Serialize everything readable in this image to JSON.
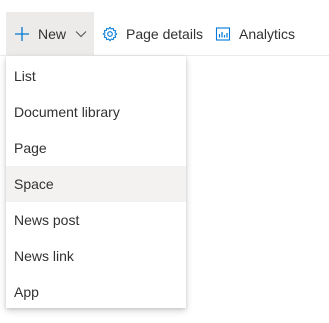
{
  "toolbar": {
    "new_label": "New",
    "page_details_label": "Page details",
    "analytics_label": "Analytics"
  },
  "new_menu": {
    "items": [
      {
        "label": "List"
      },
      {
        "label": "Document library"
      },
      {
        "label": "Page"
      },
      {
        "label": "Space"
      },
      {
        "label": "News post"
      },
      {
        "label": "News link"
      },
      {
        "label": "App"
      }
    ],
    "highlighted": "Space"
  },
  "icons": {
    "new": "plus-icon",
    "new_dropdown": "chevron-down-icon",
    "page_details": "gear-icon",
    "analytics": "analytics-icon"
  },
  "colors": {
    "text": "#323130",
    "icon": "#0078d4",
    "new_button_bg": "#edebe9",
    "highlight_bg": "#f3f2f1"
  }
}
